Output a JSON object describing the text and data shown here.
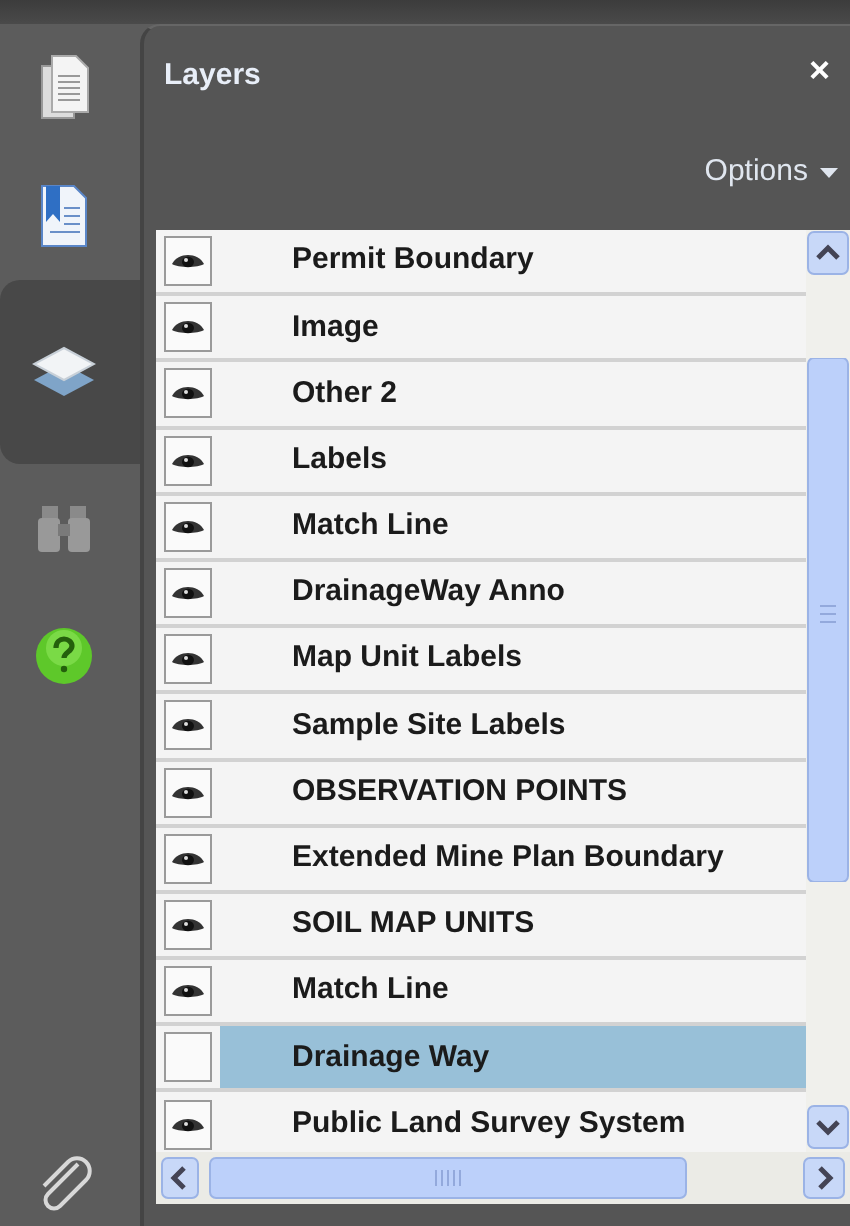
{
  "rail": [
    {
      "kind": "pages",
      "selected": false
    },
    {
      "kind": "bookmarks",
      "selected": false
    },
    {
      "kind": "layers",
      "selected": true
    },
    {
      "kind": "search",
      "selected": false
    },
    {
      "kind": "help",
      "selected": false
    },
    {
      "kind": "attachments",
      "selected": false
    }
  ],
  "panel": {
    "title": "Layers",
    "close": "×",
    "options": "Options"
  },
  "layers": [
    {
      "label": "Permit Boundary",
      "visible": true,
      "selected": false
    },
    {
      "label": "Image",
      "visible": true,
      "selected": false
    },
    {
      "label": "Other 2",
      "visible": true,
      "selected": false
    },
    {
      "label": "Labels",
      "visible": true,
      "selected": false
    },
    {
      "label": "Match Line",
      "visible": true,
      "selected": false
    },
    {
      "label": "DrainageWay Anno",
      "visible": true,
      "selected": false
    },
    {
      "label": "Map Unit Labels",
      "visible": true,
      "selected": false
    },
    {
      "label": "Sample Site Labels",
      "visible": true,
      "selected": false
    },
    {
      "label": "OBSERVATION POINTS",
      "visible": true,
      "selected": false
    },
    {
      "label": "Extended Mine Plan Boundary",
      "visible": true,
      "selected": false
    },
    {
      "label": "SOIL MAP UNITS",
      "visible": true,
      "selected": false
    },
    {
      "label": "Match Line",
      "visible": true,
      "selected": false
    },
    {
      "label": "Drainage Way",
      "visible": false,
      "selected": true
    },
    {
      "label": "Public Land Survey System",
      "visible": true,
      "selected": false
    }
  ]
}
